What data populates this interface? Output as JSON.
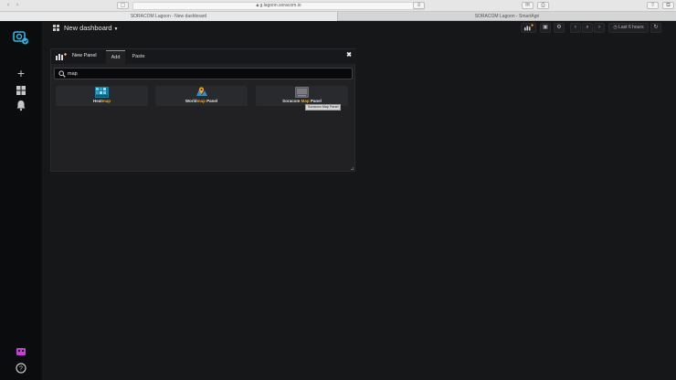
{
  "browser": {
    "url": "g.lagoon.soracom.io",
    "tabs": [
      "SORACOM Lagoon - New dashboard",
      "SORACOM Lagoon - SmartAgri"
    ]
  },
  "navbar": {
    "dashboard_title": "New dashboard",
    "time_range": "Last 6 hours"
  },
  "add_panel": {
    "title": "New Panel",
    "tabs": [
      "Add",
      "Paste"
    ],
    "search": {
      "value": "map",
      "placeholder": ""
    },
    "plugins": [
      {
        "prefix": "Heat",
        "match": "map",
        "suffix": ""
      },
      {
        "prefix": "World",
        "match": "map",
        "suffix": " Panel"
      },
      {
        "prefix": "Soracom ",
        "match": "Map",
        "suffix": " Panel"
      }
    ],
    "tooltip": "Soracom Map Panel"
  },
  "colors": {
    "accent": "#33b5e5",
    "highlight": "#f5a623",
    "sidemenu_bg": "#0b0c0e",
    "canvas_bg": "#161719"
  },
  "icons": {
    "logo": "soracom-lagoon-logo-icon",
    "create": "plus-icon",
    "dashboards": "grid-icon",
    "alerting": "bell-icon",
    "user": "user-icon",
    "help": "question-icon"
  }
}
